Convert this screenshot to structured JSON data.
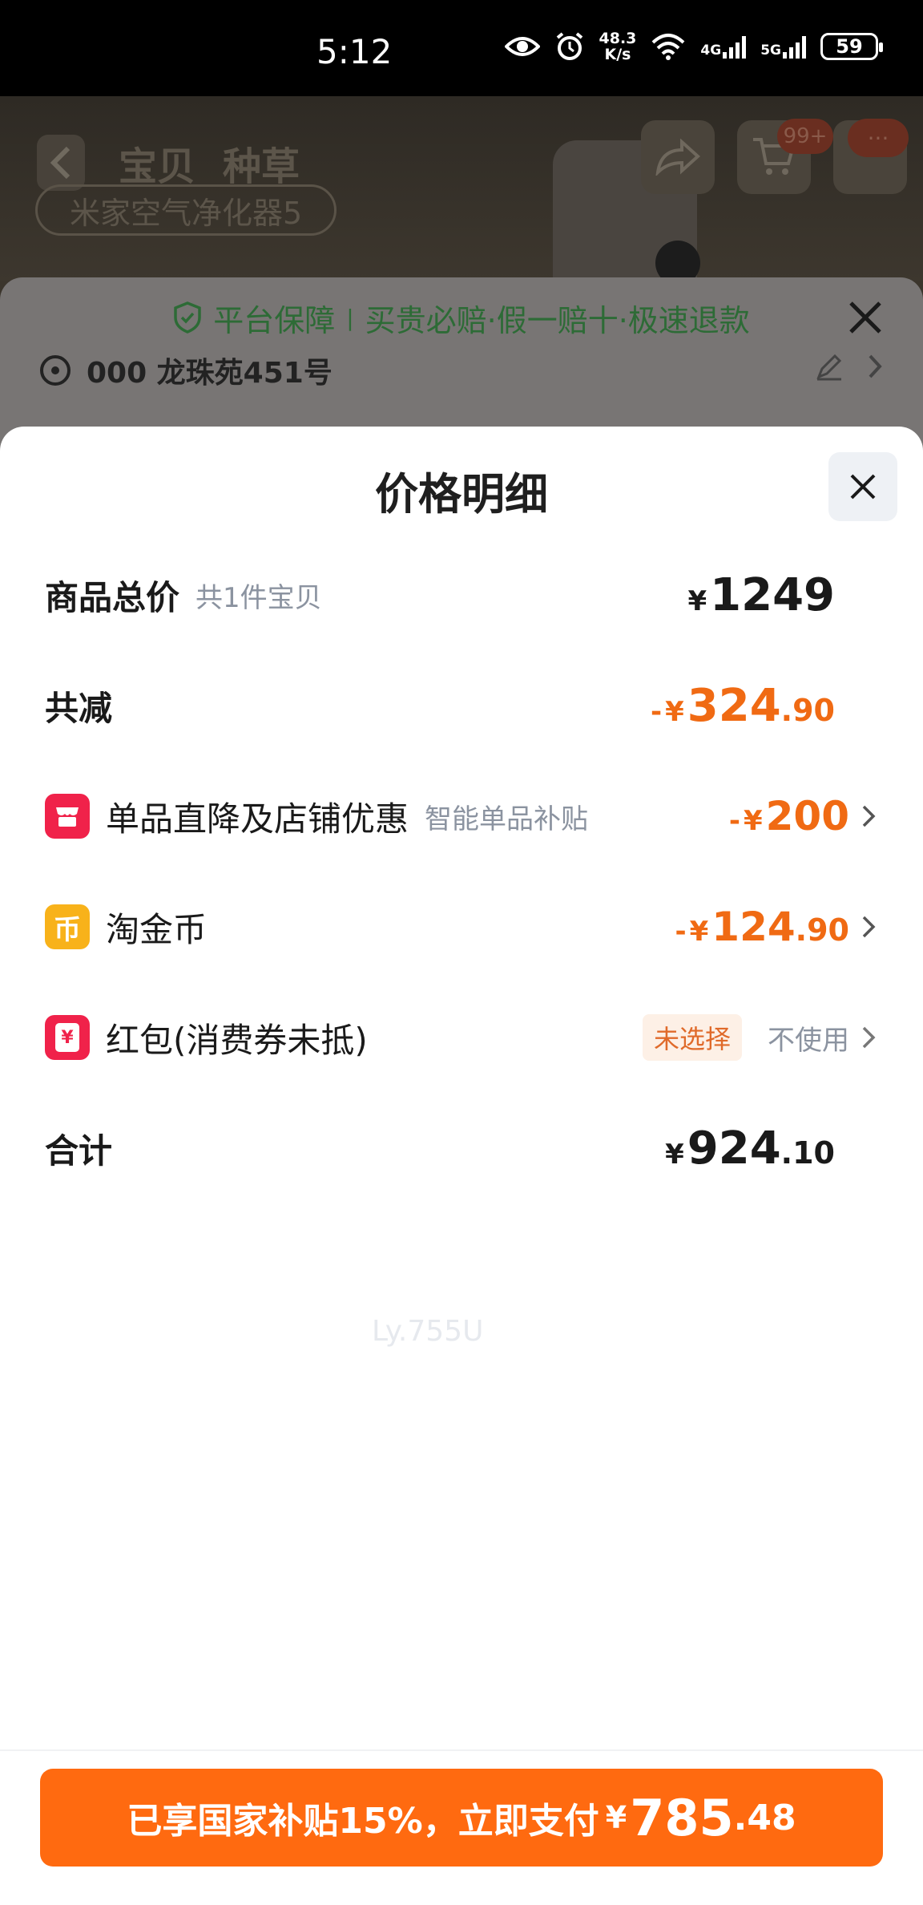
{
  "status_bar": {
    "time": "5:12",
    "net_speed_value": "48.3",
    "net_speed_unit": "K/s",
    "signal1": "4G",
    "signal2": "5G",
    "battery": "59",
    "icons": [
      "eye-icon",
      "alarm-icon",
      "wifi-icon",
      "signal-icon",
      "signal-icon",
      "battery-icon"
    ]
  },
  "background_page": {
    "tabs": [
      "宝贝",
      "种草"
    ],
    "search_text": "米家空气净化器5",
    "cart_badge": "99+",
    "more_badge": "···",
    "guarantee": {
      "title": "平台保障",
      "separator": "|",
      "details": "买贵必赔·假一赔十·极速退款"
    },
    "address": "000 龙珠苑451号"
  },
  "modal": {
    "title": "价格明细",
    "rows": {
      "total": {
        "label": "商品总价",
        "note": "共1件宝贝",
        "currency": "¥",
        "amount_int": "1249",
        "amount_dec": ""
      },
      "reduced": {
        "label": "共减",
        "sign": "-",
        "currency": "¥",
        "amount_int": "324",
        "amount_dec": ".90"
      },
      "store_discount": {
        "label": "单品直降及店铺优惠",
        "note": "智能单品补贴",
        "sign": "-",
        "currency": "¥",
        "amount_int": "200",
        "amount_dec": ""
      },
      "taojinbi": {
        "label": "淘金币",
        "icon_text": "币",
        "sign": "-",
        "currency": "¥",
        "amount_int": "124",
        "amount_dec": ".90"
      },
      "hongbao": {
        "label": "红包(消费券未抵)",
        "icon_text": "¥",
        "tag": "未选择",
        "value": "不使用"
      },
      "sum": {
        "label": "合计",
        "currency": "¥",
        "amount_int": "924",
        "amount_dec": ".10"
      }
    },
    "watermark": "Ly.755U"
  },
  "pay_button": {
    "label": "已享国家补贴15%，立即支付",
    "currency": "¥",
    "amount_int": "785",
    "amount_dec": ".48"
  },
  "colors": {
    "accent_orange": "#ff6a10",
    "price_orange": "#f06a13",
    "red_icon": "#f0224a",
    "yellow_icon": "#f8b21a",
    "guarantee_green": "#2d6b36"
  }
}
